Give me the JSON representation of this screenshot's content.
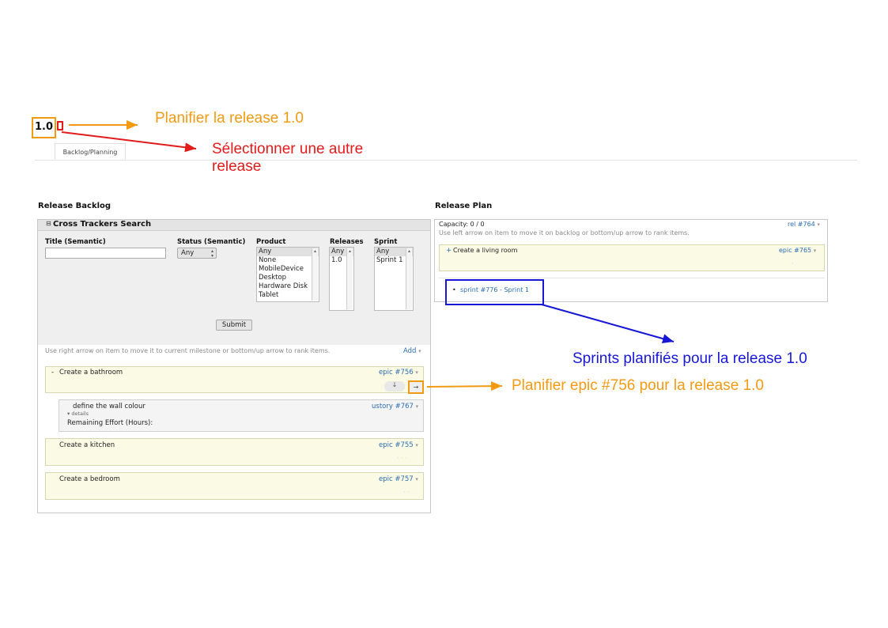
{
  "release_number": "1.0",
  "tab_label": "Backlog/Planning",
  "annotations": {
    "plan_release": "Planifier la release 1.0",
    "select_release_line1": "Sélectionner une autre",
    "select_release_line2": "release",
    "sprints_planned": "Sprints planifiés pour la release 1.0",
    "plan_epic": "Planifier epic #756 pour la release 1.0"
  },
  "colors": {
    "orange": "#f39a13",
    "red": "#e21b1b",
    "blue": "#1717d8"
  },
  "release_backlog": {
    "title": "Release Backlog",
    "search": {
      "title": "Cross Trackers Search",
      "collapse_icon": "⊟",
      "title_label": "Title (Semantic)",
      "title_value": "",
      "status_label": "Status (Semantic)",
      "status_value": "Any",
      "product_label": "Product",
      "product_options": [
        "Any",
        "None",
        "MobileDevice",
        "Desktop",
        "Hardware Disk",
        "Tablet"
      ],
      "releases_label": "Releases",
      "releases_options": [
        "Any",
        "1.0"
      ],
      "sprint_label": "Sprint",
      "sprint_options": [
        "Any",
        "Sprint 1"
      ],
      "submit_label": "Submit"
    },
    "hint": "Use right arrow on item to move it to current milestone or bottom/up arrow to rank items.",
    "add_label": "Add",
    "items": [
      {
        "title": "Create a bathroom",
        "ref": "epic #756",
        "prefix": "-"
      },
      {
        "title": "define the wall colour",
        "ref": "ustory #767",
        "details": "details",
        "effort": "Remaining Effort (Hours):"
      },
      {
        "title": "Create a kitchen",
        "ref": "epic #755"
      },
      {
        "title": "Create a bedroom",
        "ref": "epic #757"
      }
    ]
  },
  "release_plan": {
    "title": "Release Plan",
    "capacity": "Capacity: 0 / 0",
    "ref": "rel #764",
    "hint": "Use left arrow on item to move it on backlog or bottom/up arrow to rank items.",
    "item": {
      "title": "Create a living room",
      "ref": "epic #765",
      "prefix": "+"
    },
    "sprint": "sprint #776 - Sprint 1"
  },
  "icons": [
    "collapse-icon",
    "down-arrow-icon",
    "right-arrow-icon",
    "caret-down-icon"
  ]
}
